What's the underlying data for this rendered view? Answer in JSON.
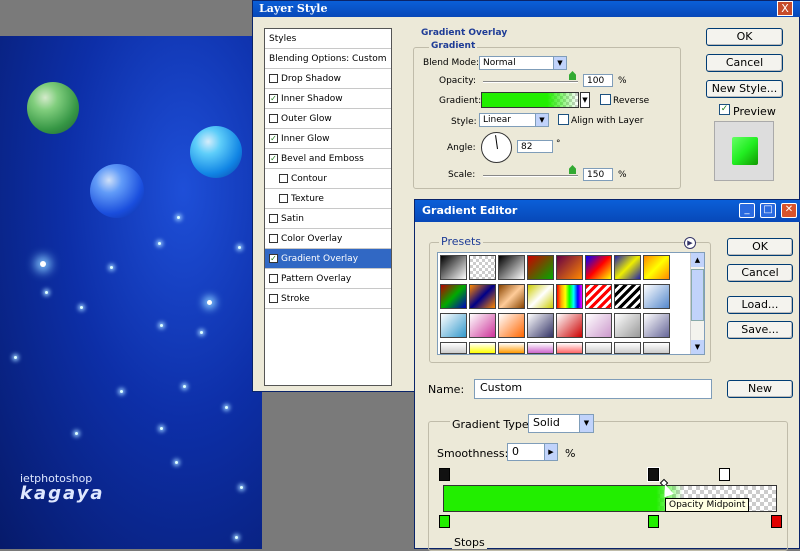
{
  "canvas": {
    "watermark_line1": "ietphotoshop",
    "watermark_line2": "kagaya"
  },
  "layer_style": {
    "title": "Layer Style",
    "close_label": "X",
    "styles_list": [
      {
        "label": "Styles",
        "checkbox": false,
        "checked": false
      },
      {
        "label": "Blending Options: Custom",
        "checkbox": false,
        "checked": false
      },
      {
        "label": "Drop Shadow",
        "checkbox": true,
        "checked": false
      },
      {
        "label": "Inner Shadow",
        "checkbox": true,
        "checked": true
      },
      {
        "label": "Outer Glow",
        "checkbox": true,
        "checked": false
      },
      {
        "label": "Inner Glow",
        "checkbox": true,
        "checked": true
      },
      {
        "label": "Bevel and Emboss",
        "checkbox": true,
        "checked": true
      },
      {
        "label": "Contour",
        "checkbox": true,
        "checked": false,
        "sub": true
      },
      {
        "label": "Texture",
        "checkbox": true,
        "checked": false,
        "sub": true
      },
      {
        "label": "Satin",
        "checkbox": true,
        "checked": false
      },
      {
        "label": "Color Overlay",
        "checkbox": true,
        "checked": false
      },
      {
        "label": "Gradient Overlay",
        "checkbox": true,
        "checked": true,
        "selected": true
      },
      {
        "label": "Pattern Overlay",
        "checkbox": true,
        "checked": false
      },
      {
        "label": "Stroke",
        "checkbox": true,
        "checked": false
      }
    ],
    "section_title": "Gradient Overlay",
    "group_title": "Gradient",
    "blend_mode_label": "Blend Mode:",
    "blend_mode_value": "Normal",
    "opacity_label": "Opacity:",
    "opacity_value": "100",
    "opacity_unit": "%",
    "gradient_label": "Gradient:",
    "reverse_label": "Reverse",
    "style_label": "Style:",
    "style_value": "Linear",
    "align_label": "Align with Layer",
    "angle_label": "Angle:",
    "angle_value": "82",
    "angle_unit": "°",
    "scale_label": "Scale:",
    "scale_value": "150",
    "scale_unit": "%",
    "ok_label": "OK",
    "cancel_label": "Cancel",
    "new_style_label": "New Style...",
    "preview_label": "Preview",
    "preview_checked": true,
    "opacity_level": 1.0,
    "scale_level": 0.78
  },
  "gradient_editor": {
    "title": "Gradient Editor",
    "presets_label": "Presets",
    "ok_label": "OK",
    "cancel_label": "Cancel",
    "load_label": "Load...",
    "save_label": "Save...",
    "name_label": "Name:",
    "name_value": "Custom",
    "new_label": "New",
    "gradient_type_label": "Gradient Type:",
    "gradient_type_value": "Solid",
    "smoothness_label": "Smoothness:",
    "smoothness_value": "0",
    "smoothness_unit": "%",
    "tooltip": "Opacity Midpoint",
    "stops_label": "Stops",
    "accent_green": "#22ee00",
    "stop_red": "#e00000"
  }
}
